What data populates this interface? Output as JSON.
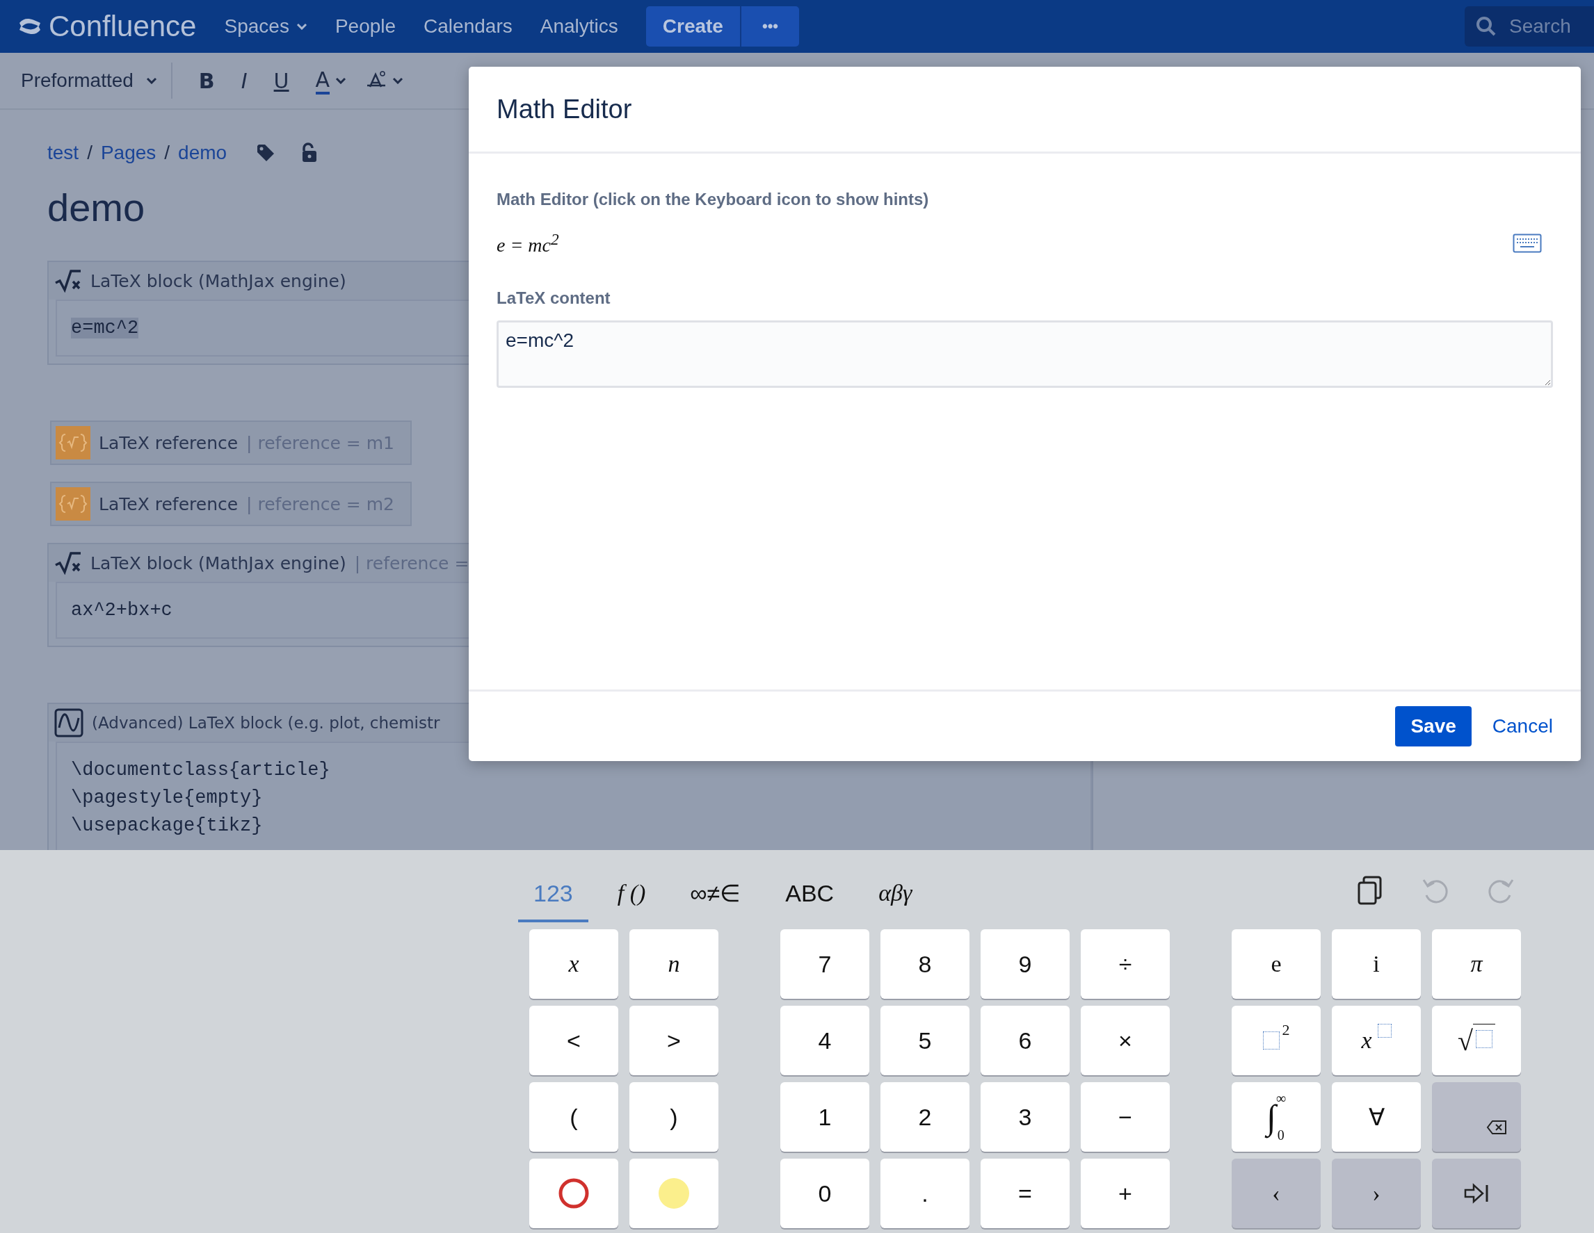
{
  "topbar": {
    "logo": "Confluence",
    "nav": [
      {
        "label": "Spaces",
        "dropdown": true
      },
      {
        "label": "People",
        "dropdown": false
      },
      {
        "label": "Calendars",
        "dropdown": false
      },
      {
        "label": "Analytics",
        "dropdown": false
      }
    ],
    "create": "Create",
    "more": "•••",
    "search": {
      "placeholder": "Search"
    }
  },
  "toolbar": {
    "format": "Preformatted",
    "bold": "B",
    "italic": "I",
    "underline": "U",
    "text_color": "A"
  },
  "breadcrumb": [
    "test",
    "Pages",
    "demo"
  ],
  "breadcrumb_separator": "/",
  "title": "demo",
  "blocks": [
    {
      "kind": "latex",
      "title": "LaTeX block (MathJax engine)",
      "code": [
        "e=mc^2"
      ],
      "highlighted": true
    },
    {
      "kind": "reference",
      "title": "LaTeX reference",
      "param": "| reference = m1"
    },
    {
      "kind": "reference",
      "title": "LaTeX reference",
      "param": "| reference = m2"
    },
    {
      "kind": "latex",
      "title": "LaTeX block (MathJax engine)",
      "param": "| reference =",
      "code": [
        "ax^2+bx+c"
      ],
      "highlighted": false
    },
    {
      "kind": "advanced",
      "title": "(Advanced) LaTeX block (e.g. plot, chemistr",
      "code": [
        "\\documentclass{article}",
        "\\pagestyle{empty}",
        "\\usepackage{tikz}"
      ]
    }
  ],
  "dialog": {
    "title": "Math Editor",
    "hint": "Math Editor (click on the Keyboard icon to show hints)",
    "preview": "e = mc$^{2}$",
    "latex_label": "LaTeX content",
    "latex_value": "e=mc^2",
    "save": "Save",
    "cancel": "Cancel"
  },
  "keyboard": {
    "tabs": [
      {
        "label": "123",
        "selected": true,
        "kind": "text"
      },
      {
        "label": "f ()",
        "selected": false,
        "kind": "math"
      },
      {
        "label": "∞≠∈",
        "selected": false,
        "kind": "text"
      },
      {
        "label": "ABC",
        "selected": false,
        "kind": "text"
      },
      {
        "label": "αβγ",
        "selected": false,
        "kind": "math"
      }
    ],
    "actions": [
      {
        "kind": "copy",
        "disabled": false
      },
      {
        "kind": "undo",
        "disabled": true
      },
      {
        "kind": "redo",
        "disabled": true
      }
    ],
    "groups": [
      {
        "keys": [
          {
            "kind": "math",
            "label": "x"
          },
          {
            "kind": "math",
            "label": "n"
          },
          {
            "kind": "text",
            "label": "<"
          },
          {
            "kind": "text",
            "label": ">"
          },
          {
            "kind": "text",
            "label": "("
          },
          {
            "kind": "text",
            "label": ")"
          },
          {
            "kind": "ring",
            "color": "#d0312d"
          },
          {
            "kind": "dot",
            "color": "#fbef8c"
          }
        ]
      },
      {
        "keys": [
          {
            "kind": "text",
            "label": "7"
          },
          {
            "kind": "text",
            "label": "8"
          },
          {
            "kind": "text",
            "label": "9"
          },
          {
            "kind": "text",
            "label": "÷"
          },
          {
            "kind": "text",
            "label": "4"
          },
          {
            "kind": "text",
            "label": "5"
          },
          {
            "kind": "text",
            "label": "6"
          },
          {
            "kind": "text",
            "label": "×"
          },
          {
            "kind": "text",
            "label": "1"
          },
          {
            "kind": "text",
            "label": "2"
          },
          {
            "kind": "text",
            "label": "3"
          },
          {
            "kind": "text",
            "label": "−"
          },
          {
            "kind": "text",
            "label": "0"
          },
          {
            "kind": "text",
            "label": "."
          },
          {
            "kind": "text",
            "label": "="
          },
          {
            "kind": "text",
            "label": "+"
          }
        ]
      },
      {
        "keys": [
          {
            "kind": "serif",
            "label": "e"
          },
          {
            "kind": "serif",
            "label": "i"
          },
          {
            "kind": "math",
            "label": "π"
          },
          {
            "kind": "square",
            "label": "2"
          },
          {
            "kind": "power",
            "label": "x"
          },
          {
            "kind": "sqrt",
            "label": "√"
          },
          {
            "kind": "integral",
            "label": "∫",
            "upper": "∞",
            "lower": "0"
          },
          {
            "kind": "serif",
            "label": "∀"
          },
          {
            "kind": "delete"
          },
          {
            "kind": "nav",
            "label": "‹"
          },
          {
            "kind": "nav",
            "label": "›"
          },
          {
            "kind": "tab"
          }
        ]
      }
    ]
  }
}
